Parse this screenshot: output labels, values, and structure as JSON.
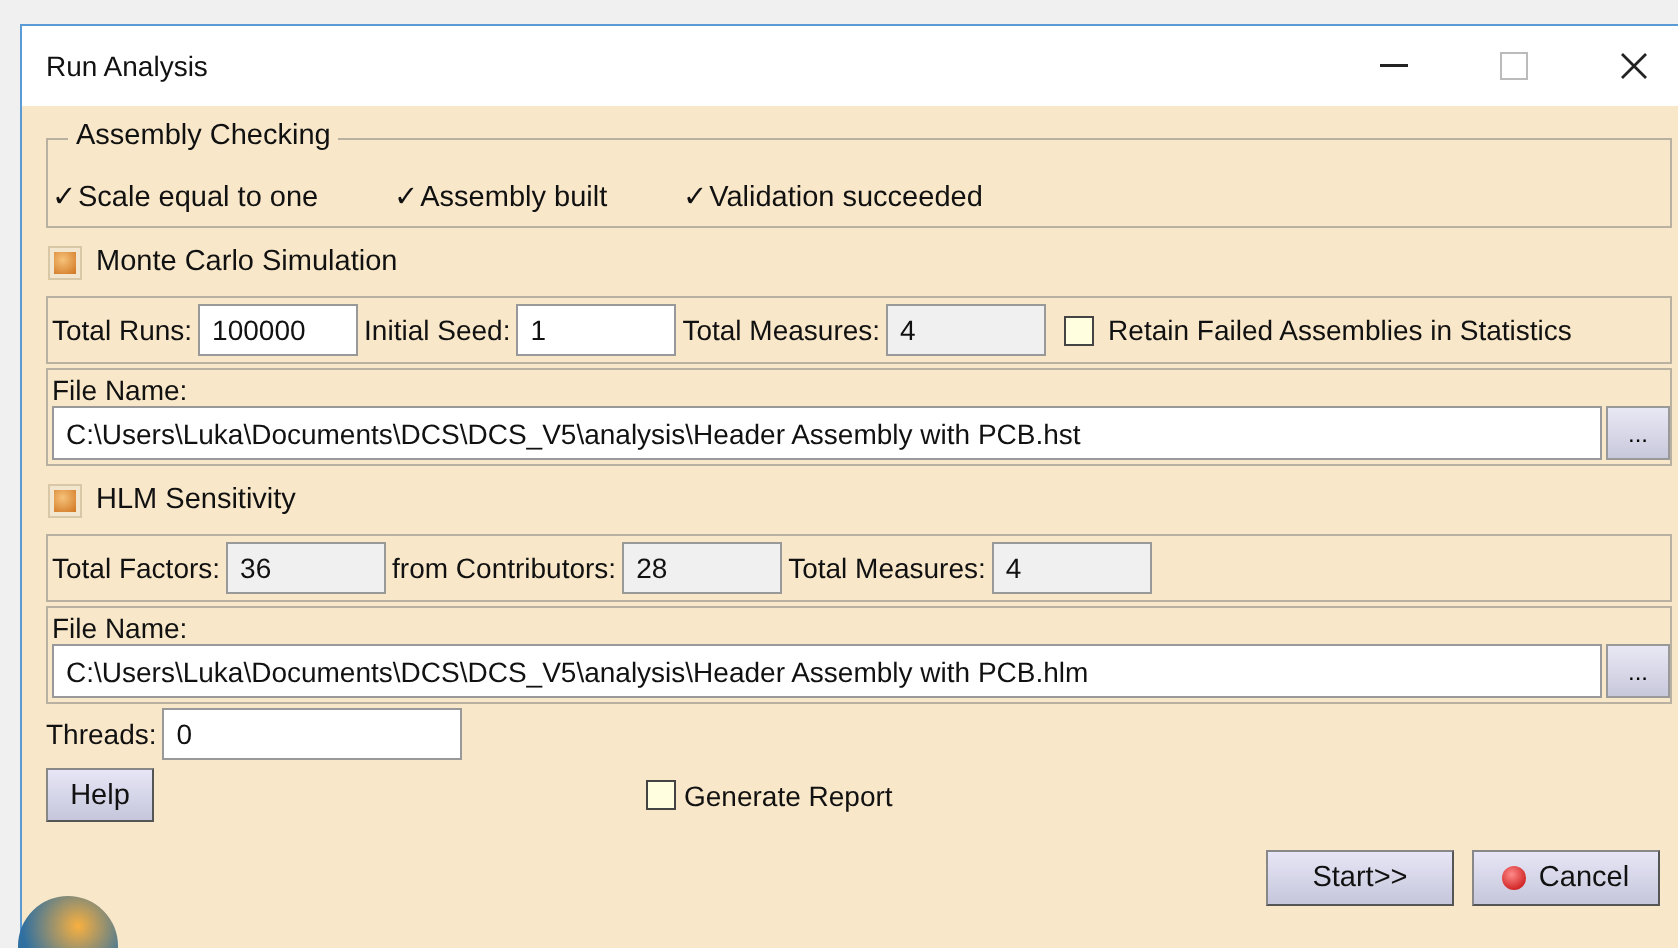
{
  "window": {
    "title": "Run Analysis"
  },
  "assembly_checking": {
    "title": "Assembly Checking",
    "items": [
      "✓Scale equal to one",
      "✓Assembly built",
      "✓Validation succeeded"
    ]
  },
  "monte_carlo": {
    "label": "Monte Carlo Simulation",
    "checked": true,
    "total_runs": {
      "label": "Total Runs:",
      "value": "100000"
    },
    "initial_seed": {
      "label": "Initial Seed:",
      "value": "1"
    },
    "total_measures": {
      "label": "Total Measures:",
      "value": "4"
    },
    "retain_failed": {
      "label": "Retain Failed Assemblies in Statistics",
      "checked": false
    },
    "file": {
      "label": "File Name:",
      "value": "C:\\Users\\Luka\\Documents\\DCS\\DCS_V5\\analysis\\Header Assembly with PCB.hst",
      "browse": "..."
    }
  },
  "hlm": {
    "label": "HLM Sensitivity",
    "checked": true,
    "total_factors": {
      "label": "Total Factors:",
      "value": "36"
    },
    "contributors": {
      "label": "from Contributors:",
      "value": "28"
    },
    "total_measures": {
      "label": "Total Measures:",
      "value": "4"
    },
    "file": {
      "label": "File Name:",
      "value": "C:\\Users\\Luka\\Documents\\DCS\\DCS_V5\\analysis\\Header Assembly with PCB.hlm",
      "browse": "..."
    }
  },
  "threads": {
    "label": "Threads:",
    "value": "0"
  },
  "help_button": "Help",
  "generate_report": {
    "label": "Generate Report",
    "checked": false
  },
  "buttons": {
    "start": "Start>>",
    "cancel": "Cancel"
  }
}
